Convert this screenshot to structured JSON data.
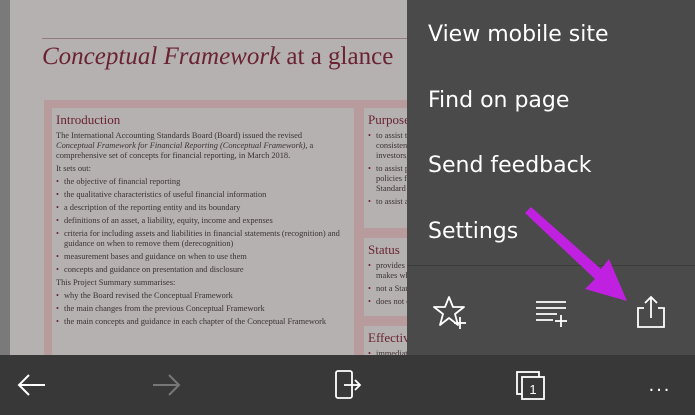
{
  "document": {
    "title_italic": "Conceptual Framework",
    "title_rest": " at a glance",
    "intro": {
      "heading": "Introduction",
      "line1": "The International Accounting Standards Board (Board) issued the revised",
      "line2_italic": "Conceptual Framework for Financial Reporting (Conceptual Framework)",
      "line2_rest": ", a",
      "line3": "comprehensive set of concepts for financial reporting, in March 2018.",
      "sets_out": "It sets out:",
      "bullets": [
        "the objective of financial reporting",
        "the qualitative characteristics of useful financial information",
        "a description of the reporting entity and its boundary",
        "definitions of an asset, a liability, equity, income and expenses",
        "criteria for including assets and liabilities in financial statements (recognition) and guidance on when to remove them (derecognition)",
        "measurement bases and guidance on when to use them",
        "concepts and guidance on presentation and disclosure"
      ],
      "summary_line": "This Project Summary summarises:",
      "summary_bullets": [
        "why the Board revised the Conceptual Framework",
        "the main changes from the previous Conceptual Framework",
        "the main concepts and guidance in each chapter of the Conceptual Framework"
      ]
    },
    "purpose": {
      "heading": "Purpose",
      "bullets": [
        "to assist the",
        "consistent c",
        "investors, le",
        "to assist pre",
        "policies for",
        "Standard ap",
        "to assist all"
      ]
    },
    "status": {
      "heading": "Status",
      "bullets": [
        "provides co",
        "makes whe",
        "not a Stand",
        "does not ov"
      ]
    },
    "effective": {
      "heading": "Effective",
      "bullets": [
        "immediate"
      ]
    }
  },
  "menu": {
    "items": [
      "View mobile site",
      "Find on page",
      "Send feedback",
      "Settings"
    ],
    "icons": [
      "star-plus-icon",
      "reading-list-add-icon",
      "share-icon"
    ]
  },
  "bottombar": {
    "icons": [
      "back-arrow-icon",
      "forward-arrow-icon",
      "continue-on-pc-icon",
      "tabs-icon",
      "more-icon"
    ],
    "tab_count": "1",
    "more": "..."
  },
  "colors": {
    "menu_bg": "#4a4a4a",
    "bar_bg": "#383838",
    "annotation_arrow": "#c020e0",
    "doc_title": "#6a2333"
  }
}
